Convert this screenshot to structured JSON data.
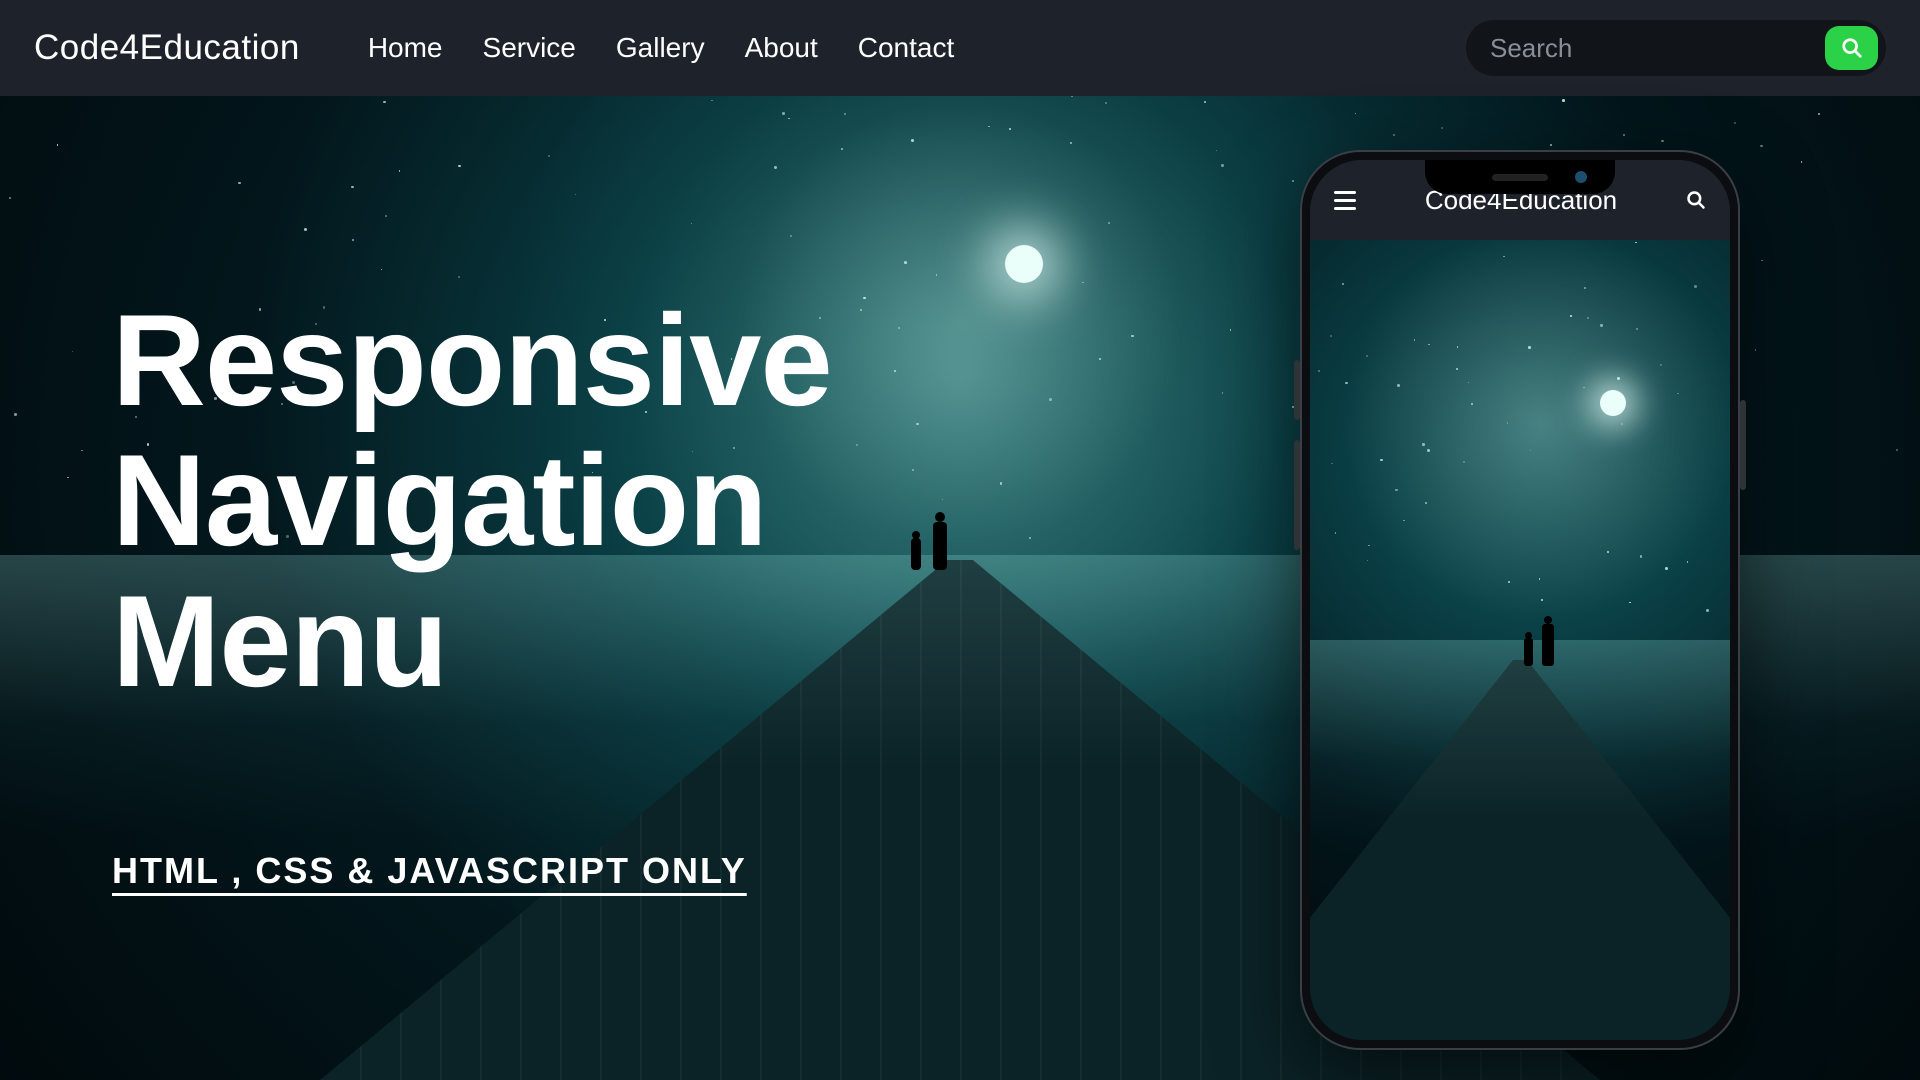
{
  "brand": "Code4Education",
  "nav": {
    "items": [
      "Home",
      "Service",
      "Gallery",
      "About",
      "Contact"
    ],
    "search_placeholder": "Search"
  },
  "hero": {
    "line1": "Responsive",
    "line2": "Navigation",
    "line3": "Menu"
  },
  "subtitle": "HTML , CSS & JAVASCRIPT ONLY",
  "phone": {
    "brand": "Code4Education"
  },
  "colors": {
    "navbar": "#1e232b",
    "accent": "#2bd146"
  }
}
